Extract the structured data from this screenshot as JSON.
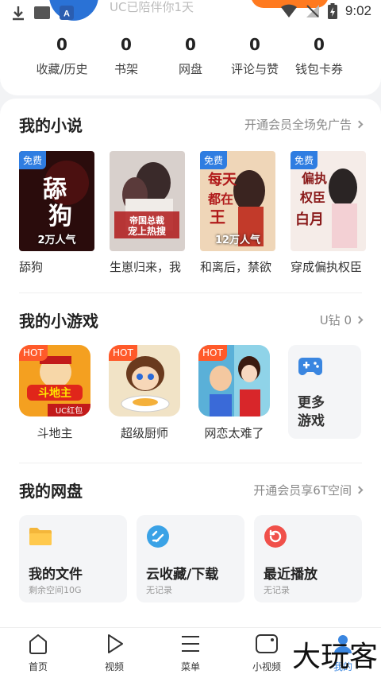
{
  "status_bar": {
    "time": "9:02"
  },
  "profile": {
    "accompany_text": "UC已陪伴你1天"
  },
  "stats": [
    {
      "value": "0",
      "label": "收藏/历史"
    },
    {
      "value": "0",
      "label": "书架"
    },
    {
      "value": "0",
      "label": "网盘"
    },
    {
      "value": "0",
      "label": "评论与赞"
    },
    {
      "value": "0",
      "label": "钱包卡券"
    }
  ],
  "novels": {
    "title": "我的小说",
    "link": "开通会员全场免广告",
    "items": [
      {
        "title": "舔狗",
        "badge": "免费",
        "popularity": "2万人气",
        "cover_text": "舔狗",
        "color": "#2a0c0c"
      },
      {
        "title": "生崽归来，我",
        "badge": "",
        "popularity": "",
        "cover_text": "帝国总裁宠上热搜",
        "color": "#c9c4c2"
      },
      {
        "title": "和离后，禁欲",
        "badge": "免费",
        "popularity": "12万人气",
        "cover_text": "每天都在被欲王",
        "color": "#e8c9a8"
      },
      {
        "title": "穿成偏执权臣",
        "badge": "免费",
        "popularity": "",
        "cover_text": "偏执权臣的白月光",
        "color": "#f3e7e2"
      }
    ]
  },
  "games": {
    "title": "我的小游戏",
    "link": "U钻 0",
    "items": [
      {
        "title": "斗地主",
        "badge": "HOT",
        "icon_text": "斗地主",
        "sub_text": "UC红包",
        "color": "#f4a020"
      },
      {
        "title": "超级厨师",
        "badge": "HOT",
        "color": "#f1e3c6"
      },
      {
        "title": "网恋太难了",
        "badge": "HOT",
        "color": "#8fd3e8"
      }
    ],
    "more_label": "更多游戏"
  },
  "disk": {
    "title": "我的网盘",
    "link": "开通会员享6T空间",
    "items": [
      {
        "title": "我的文件",
        "subtitle": "剩余空间10G",
        "icon": "folder-icon"
      },
      {
        "title": "云收藏/下载",
        "subtitle": "无记录",
        "icon": "cloud-collect-icon"
      },
      {
        "title": "最近播放",
        "subtitle": "无记录",
        "icon": "recent-play-icon"
      }
    ]
  },
  "nav": [
    {
      "label": "首页"
    },
    {
      "label": "视频"
    },
    {
      "label": "菜单"
    },
    {
      "label": "小视频"
    },
    {
      "label": "我的"
    }
  ],
  "watermark": "大玩客",
  "colors": {
    "accent_blue": "#2f7de1",
    "hot_orange": "#ff5a2a",
    "brand_orange": "#ff7a1f"
  }
}
